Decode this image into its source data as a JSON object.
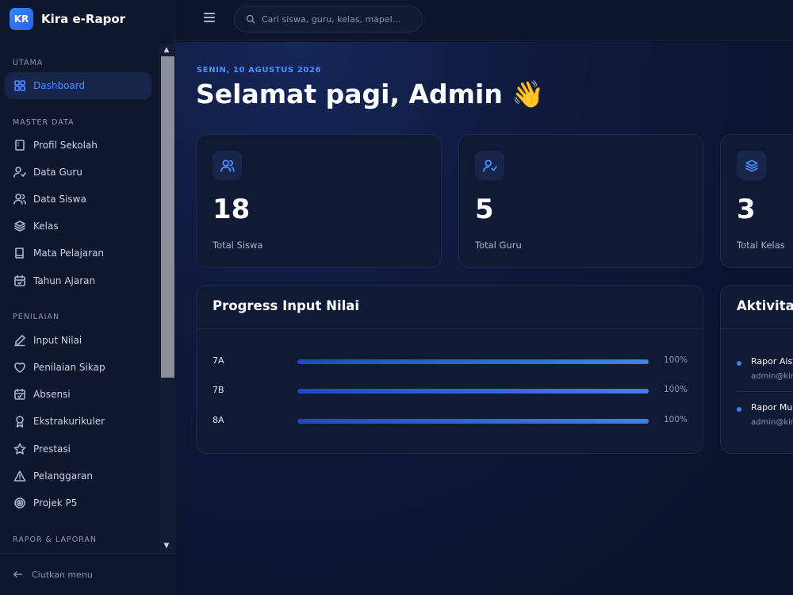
{
  "brand": {
    "logo": "KR",
    "name": "Kira e-Rapor"
  },
  "sidebar": {
    "sections": [
      {
        "label": "UTAMA",
        "items": [
          {
            "label": "Dashboard",
            "icon": "grid-icon",
            "active": true
          }
        ]
      },
      {
        "label": "MASTER DATA",
        "items": [
          {
            "label": "Profil Sekolah",
            "icon": "building-icon"
          },
          {
            "label": "Data Guru",
            "icon": "user-check-icon"
          },
          {
            "label": "Data Siswa",
            "icon": "users-icon"
          },
          {
            "label": "Kelas",
            "icon": "layers-icon"
          },
          {
            "label": "Mata Pelajaran",
            "icon": "book-icon"
          },
          {
            "label": "Tahun Ajaran",
            "icon": "calendar-icon"
          }
        ]
      },
      {
        "label": "PENILAIAN",
        "items": [
          {
            "label": "Input Nilai",
            "icon": "pencil-icon"
          },
          {
            "label": "Penilaian Sikap",
            "icon": "heart-icon"
          },
          {
            "label": "Absensi",
            "icon": "calendar-check-icon"
          },
          {
            "label": "Ekstrakurikuler",
            "icon": "award-icon"
          },
          {
            "label": "Prestasi",
            "icon": "star-icon"
          },
          {
            "label": "Pelanggaran",
            "icon": "alert-triangle-icon"
          },
          {
            "label": "Projek P5",
            "icon": "target-icon"
          }
        ]
      },
      {
        "label": "RAPOR & LAPORAN",
        "items": []
      }
    ],
    "footer_label": "Ciutkan menu"
  },
  "topbar": {
    "search_placeholder": "Cari siswa, guru, kelas, mapel..."
  },
  "main": {
    "date": "SENIN, 10 AGUSTUS 2026",
    "greeting": "Selamat pagi, Admin 👋",
    "stats": [
      {
        "value": "18",
        "label": "Total Siswa",
        "icon": "users-icon"
      },
      {
        "value": "5",
        "label": "Total Guru",
        "icon": "user-check-icon"
      },
      {
        "value": "3",
        "label": "Total Kelas",
        "icon": "layers-icon"
      }
    ],
    "progress": {
      "title": "Progress Input Nilai",
      "rows": [
        {
          "label": "7A",
          "percent": 100,
          "percent_label": "100%"
        },
        {
          "label": "7B",
          "percent": 100,
          "percent_label": "100%"
        },
        {
          "label": "8A",
          "percent": 100,
          "percent_label": "100%"
        }
      ]
    },
    "activity": {
      "title": "Aktivitas",
      "items": [
        {
          "title": "Rapor Aisy",
          "sub": "admin@kira"
        },
        {
          "title": "Rapor Muh",
          "sub": "admin@kira"
        }
      ]
    }
  },
  "colors": {
    "accent": "#3b82f6",
    "background": "#0c1226",
    "card": "#101a35"
  }
}
